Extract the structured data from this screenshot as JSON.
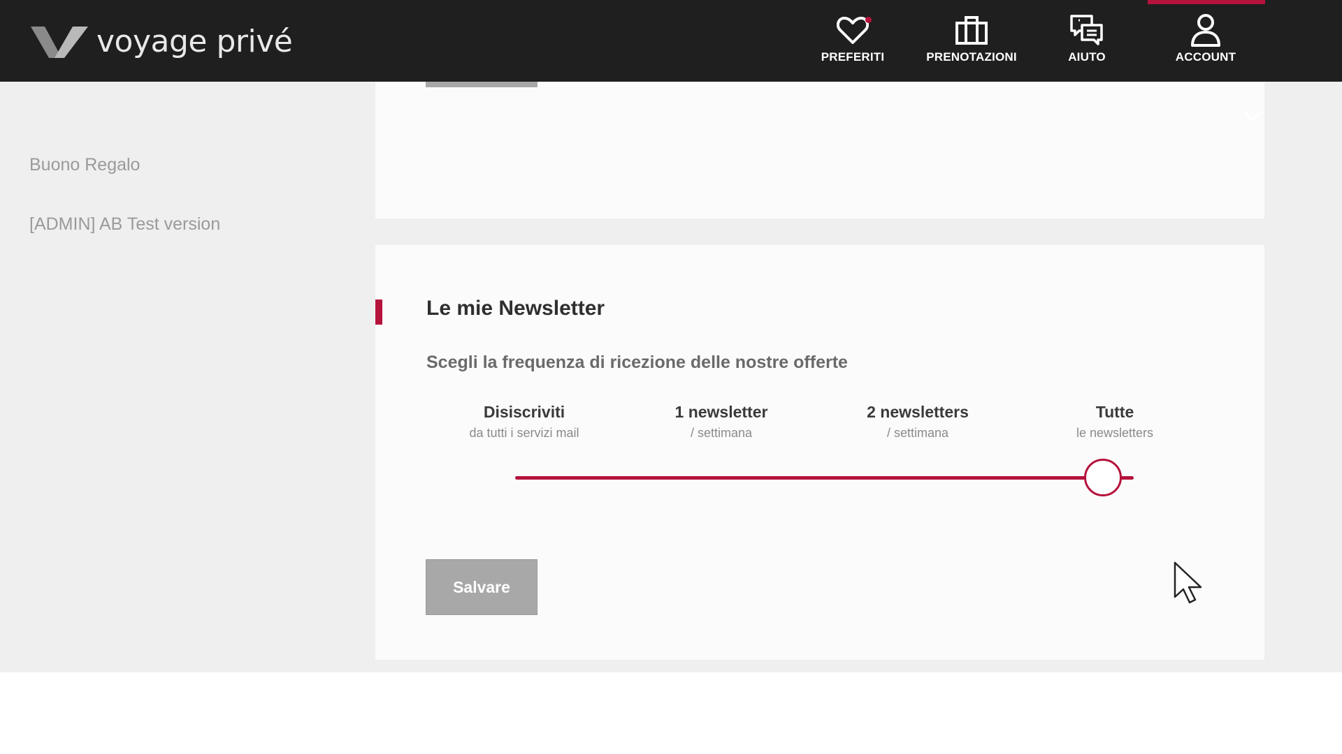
{
  "header": {
    "logo_text": "voyage privé",
    "nav": [
      {
        "label": "PREFERITI",
        "icon": "heart-icon"
      },
      {
        "label": "PRENOTAZIONI",
        "icon": "suitcase-icon"
      },
      {
        "label": "AIUTO",
        "icon": "chat-icon"
      },
      {
        "label": "ACCOUNT",
        "icon": "user-icon"
      }
    ],
    "colors": {
      "background": "#1f1f1f",
      "accent": "#b5123c"
    }
  },
  "sidebar": {
    "items": [
      {
        "label": "Buono Regalo"
      },
      {
        "label": "[ADMIN] AB Test version"
      }
    ]
  },
  "newsletter": {
    "title": "Le mie Newsletter",
    "subtitle": "Scegli la frequenza di ricezione delle nostre offerte",
    "options": [
      {
        "title": "Disiscriviti",
        "sub": "da tutti i servizi mail"
      },
      {
        "title": "1 newsletter",
        "sub": "/ settimana"
      },
      {
        "title": "2 newsletters",
        "sub": "/ settimana"
      },
      {
        "title": "Tutte",
        "sub": "le newsletters"
      }
    ],
    "slider": {
      "selected_index": 3,
      "level": 1.0
    },
    "save_label": "Salvare"
  }
}
